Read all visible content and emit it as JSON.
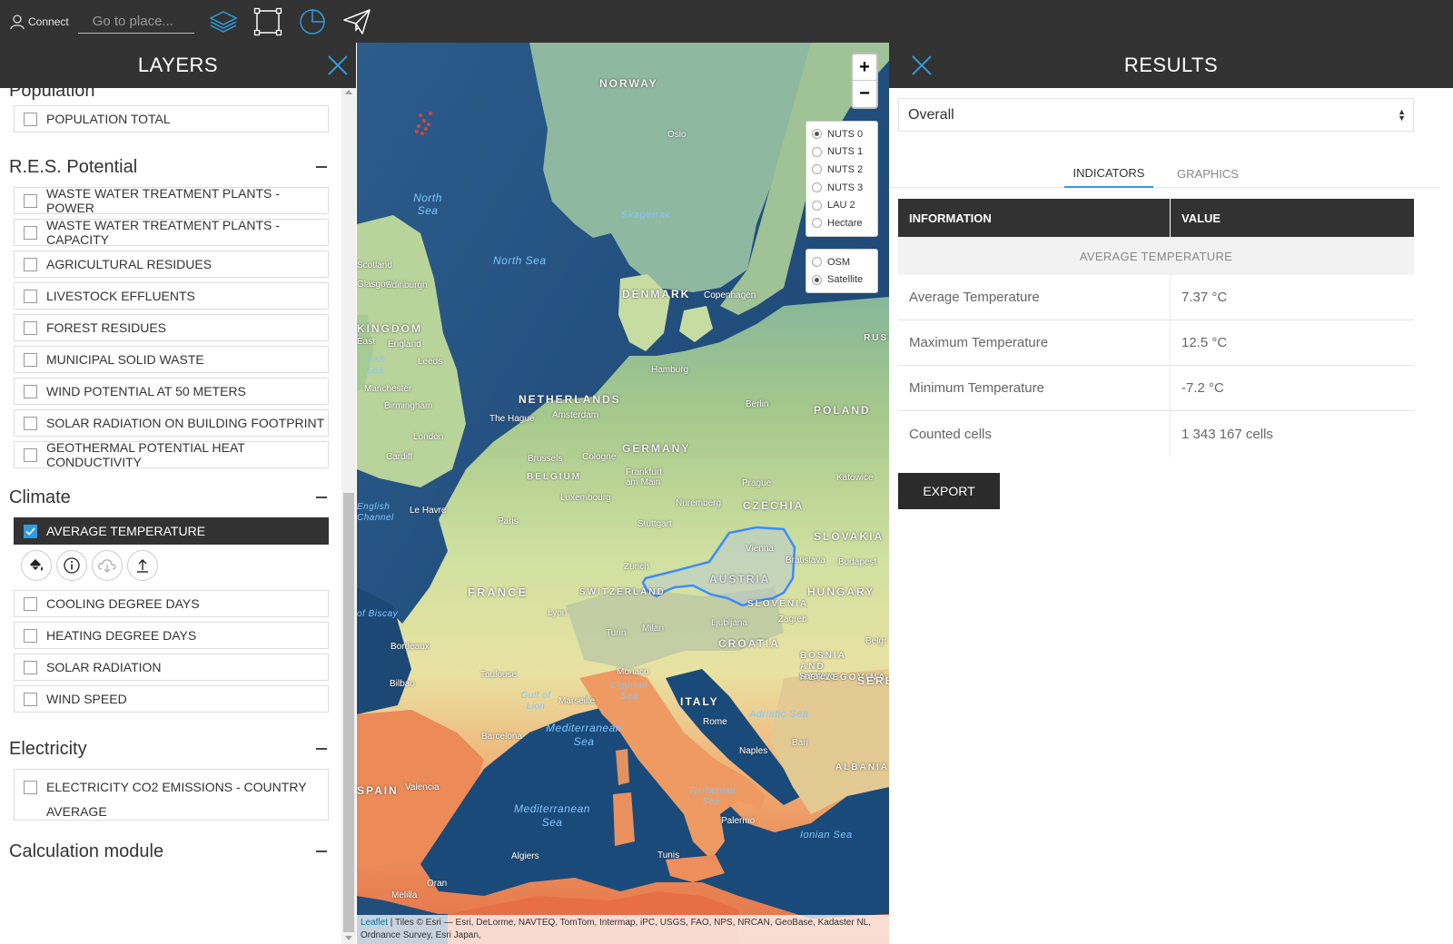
{
  "topbar": {
    "connect_label": "Connect",
    "search_placeholder": "Go to place...",
    "tools": [
      "layers-icon",
      "selection-box-icon",
      "pie-chart-icon",
      "send-icon"
    ]
  },
  "layers_panel": {
    "title": "LAYERS",
    "sections": [
      {
        "name": "Population",
        "items": [
          {
            "label": "POPULATION TOTAL",
            "checked": false
          }
        ]
      },
      {
        "name": "R.E.S. Potential",
        "items": [
          {
            "label": "WASTE WATER TREATMENT PLANTS - POWER",
            "checked": false
          },
          {
            "label": "WASTE WATER TREATMENT PLANTS - CAPACITY",
            "checked": false
          },
          {
            "label": "AGRICULTURAL RESIDUES",
            "checked": false
          },
          {
            "label": "LIVESTOCK EFFLUENTS",
            "checked": false
          },
          {
            "label": "FOREST RESIDUES",
            "checked": false
          },
          {
            "label": "MUNICIPAL SOLID WASTE",
            "checked": false
          },
          {
            "label": "WIND POTENTIAL AT 50 METERS",
            "checked": false
          },
          {
            "label": "SOLAR RADIATION ON BUILDING FOOTPRINT",
            "checked": false
          },
          {
            "label": "GEOTHERMAL POTENTIAL HEAT CONDUCTIVITY",
            "checked": false
          }
        ]
      },
      {
        "name": "Climate",
        "items": [
          {
            "label": "AVERAGE TEMPERATURE",
            "checked": true
          },
          {
            "label": "COOLING DEGREE DAYS",
            "checked": false
          },
          {
            "label": "HEATING DEGREE DAYS",
            "checked": false
          },
          {
            "label": "SOLAR RADIATION",
            "checked": false
          },
          {
            "label": "WIND SPEED",
            "checked": false
          }
        ]
      },
      {
        "name": "Electricity",
        "items": [
          {
            "label": "ELECTRICITY CO2 EMISSIONS - COUNTRY AVERAGE",
            "checked": false
          }
        ]
      },
      {
        "name": "Calculation module",
        "items": []
      }
    ],
    "layer_actions": [
      "paint-bucket-icon",
      "info-icon",
      "cloud-download-icon",
      "upload-icon"
    ]
  },
  "map": {
    "zoom_in": "+",
    "zoom_out": "−",
    "nuts_options": [
      "NUTS 0",
      "NUTS 1",
      "NUTS 2",
      "NUTS 3",
      "LAU 2",
      "Hectare"
    ],
    "nuts_selected": "NUTS 0",
    "base_options": [
      "OSM",
      "Satellite"
    ],
    "base_selected": "Satellite",
    "labels": {
      "countries": [
        "NORWAY",
        "DENMARK",
        "KINGDOM",
        "NETHERLANDS",
        "GERMANY",
        "POLAND",
        "BELGIUM",
        "CZECHIA",
        "SLOVAKIA",
        "AUSTRIA",
        "FRANCE",
        "SWITZERLAND",
        "HUNGARY",
        "SLOVENIA",
        "CROATIA",
        "BOSNIA AND HERZEGOVINA",
        "ITALY",
        "SPAIN",
        "ALBANIA",
        "SERB",
        "RUSS"
      ],
      "waters": [
        "North Sea",
        "North Sea",
        "Skagerrak",
        "Irish Sea",
        "English Channel",
        "of Biscay",
        "Gulf of Lion",
        "Ligurian Sea",
        "Mediterranean Sea",
        "Mediterranean Sea",
        "Adriatic Sea",
        "Tyrrhenian Sea",
        "Ionian Sea"
      ],
      "cities": [
        "Oslo",
        "Edinburgh",
        "Copenhagen",
        "Hamburg",
        "Berlin",
        "The Hague",
        "Amsterdam",
        "Leeds",
        "Manchester",
        "Birmingham",
        "London",
        "Cardiff",
        "Brussels",
        "Cologne",
        "Luxembourg",
        "Frankfurt am Main",
        "Prague",
        "Katowice",
        "Nuremberg",
        "Stuttgart",
        "Paris",
        "Le Havre",
        "Vienna",
        "Bratislava",
        "Budapest",
        "Zurich",
        "Lyon",
        "Turin",
        "Milan",
        "Zagreb",
        "Ljubljana",
        "Bordeaux",
        "Bilbao",
        "Toulouse",
        "Marseille",
        "Monaco",
        "Barcelona",
        "Valencia",
        "Rome",
        "Naples",
        "Bari",
        "Sarajevo",
        "Palermo",
        "Tunis",
        "Algiers",
        "Oran",
        "Melilla",
        "Belgr",
        "Glasgow",
        "England",
        "Scotland",
        "East"
      ]
    },
    "attribution_link": "Leaflet",
    "attribution_text": " | Tiles © Esri — Esri, DeLorme, NAVTEQ, TomTom, Intermap, iPC, USGS, FAO, NPS, NRCAN, GeoBase, Kadaster NL, Ordnance Survey, Esri Japan,"
  },
  "results_panel": {
    "title": "RESULTS",
    "select_value": "Overall",
    "tabs": [
      "INDICATORS",
      "GRAPHICS"
    ],
    "active_tab": "INDICATORS",
    "table": {
      "headers": [
        "INFORMATION",
        "VALUE"
      ],
      "group": "AVERAGE TEMPERATURE",
      "rows": [
        {
          "label": "Average Temperature",
          "value": "7.37 °C"
        },
        {
          "label": "Maximum Temperature",
          "value": "12.5 °C"
        },
        {
          "label": "Minimum Temperature",
          "value": "-7.2 °C"
        },
        {
          "label": "Counted cells",
          "value": "1 343 167 cells"
        }
      ]
    },
    "export_label": "EXPORT"
  },
  "colors": {
    "dark_bar": "#323232",
    "accent": "#2f9be0",
    "selection_outline": "#3d8bff"
  }
}
